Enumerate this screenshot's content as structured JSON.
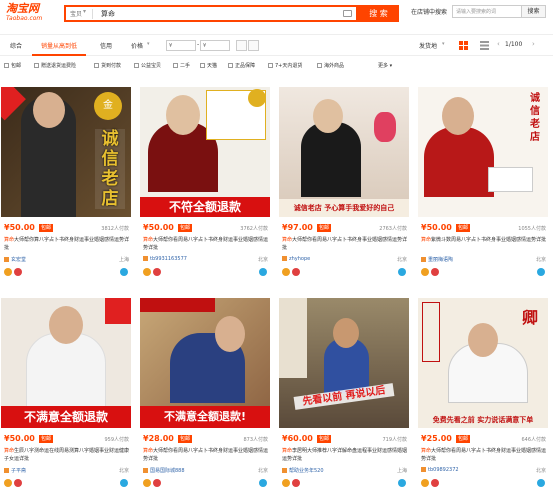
{
  "header": {
    "logo_cn": "淘宝网",
    "logo_en": "Taobao.com",
    "scope": "宝贝",
    "query": "算命",
    "search_btn": "搜 索",
    "shop_search_label": "在店铺中搜索",
    "shop_search_placeholder": "请输入要搜索的词",
    "shop_search_btn": "搜索"
  },
  "sortbar": {
    "tabs": [
      "综合",
      "销量从高到低",
      "信用",
      "价格"
    ],
    "price_from": "¥",
    "price_to": "¥",
    "ship_from": "发货地",
    "page": "1/100"
  },
  "filters": [
    "包邮",
    "赠送退货运费险",
    "货到付款",
    "公益宝贝",
    "二手",
    "天猫",
    "正品保障",
    "7+天内退货",
    "海外商品",
    "更多"
  ],
  "products": [
    {
      "price": "¥50.00",
      "tag": "包邮",
      "sales": "3812人付款",
      "title_hl": "算命",
      "title": "大师帮你算八字占卜书终身财运事业婚姻感情运势详批",
      "shop": "玄宏堂",
      "loc": "上海",
      "stamp": "诚信老店"
    },
    {
      "price": "¥50.00",
      "tag": "包邮",
      "sales": "3762人付款",
      "title_hl": "算命",
      "title": "大师帮你看周易八字占卜书终身财运事业婚姻感情运势详批",
      "shop": "tb9931163577",
      "loc": "北京",
      "stamp": "不符全额退款"
    },
    {
      "price": "¥97.00",
      "tag": "包邮",
      "sales": "2763人付款",
      "title_hl": "算命",
      "title": "大师帮你看周易八字占卜书终身事业婚姻感情运势详批",
      "shop": "zhyhope",
      "loc": "北京",
      "stamp": "诚信老店 予心算手我爱好的自己"
    },
    {
      "price": "¥50.00",
      "tag": "包邮",
      "sales": "1055人付款",
      "title_hl": "算命",
      "title": "紫微斗数周易八字占卜书终身事业婚姻感情运势详批",
      "shop": "重丽梅语陶",
      "loc": "北京",
      "stamp": "诚信老店"
    },
    {
      "price": "¥50.00",
      "tag": "包邮",
      "sales": "959人付款",
      "title_hl": "算命",
      "title": "生辰八字测命运在线周易测算八字婚姻事业财运健康子女运详批",
      "shop": "子平斋",
      "loc": "北京",
      "stamp": "不满意全额退款"
    },
    {
      "price": "¥28.00",
      "tag": "包邮",
      "sales": "873人付款",
      "title_hl": "算命",
      "title": "大师帮你看周易八字占卜书终身财运事业婚姻感情运势详批",
      "shop": "国易国际城888",
      "loc": "北京",
      "stamp": "不满意全额退款!"
    },
    {
      "price": "¥60.00",
      "tag": "包邮",
      "sales": "719人付款",
      "title_hl": "算命",
      "title": "李居明大师推荐八字详解命盘运程事业财运感情婚姻运势详批",
      "shop": "帮助业务年520",
      "loc": "上海",
      "stamp": "先看以前 再说以后"
    },
    {
      "price": "¥25.00",
      "tag": "包邮",
      "sales": "646人付款",
      "title_hl": "算命",
      "title": "大师帮你看周易八字占卜书终身财运事业婚姻感情运势详批",
      "shop": "tb09892372",
      "loc": "北京",
      "stamp": "免费先看之前 实力说话满意下单"
    }
  ]
}
